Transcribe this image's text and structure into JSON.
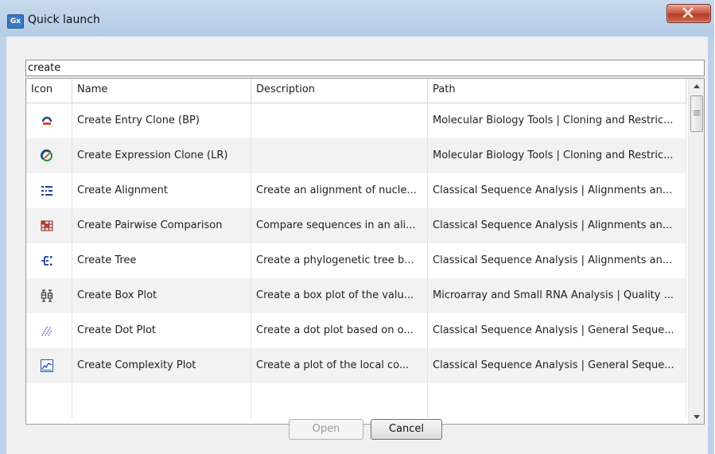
{
  "window": {
    "title": "Quick launch",
    "app_badge": "Gx"
  },
  "search": {
    "value": "create"
  },
  "table": {
    "columns": [
      "Icon",
      "Name",
      "Description",
      "Path"
    ],
    "rows": [
      {
        "icon": "entry-clone-icon",
        "name": "Create Entry Clone (BP)",
        "description": "",
        "path": "Molecular Biology Tools | Cloning and Restric..."
      },
      {
        "icon": "expression-clone-icon",
        "name": "Create Expression Clone (LR)",
        "description": "",
        "path": "Molecular Biology Tools | Cloning and Restric..."
      },
      {
        "icon": "alignment-icon",
        "name": "Create Alignment",
        "description": "Create an alignment of nucle...",
        "path": "Classical Sequence Analysis | Alignments an..."
      },
      {
        "icon": "pairwise-comparison-icon",
        "name": "Create Pairwise Comparison",
        "description": "Compare sequences in an ali...",
        "path": "Classical Sequence Analysis | Alignments an..."
      },
      {
        "icon": "tree-icon",
        "name": "Create Tree",
        "description": "Create a phylogenetic tree b...",
        "path": "Classical Sequence Analysis | Alignments an..."
      },
      {
        "icon": "box-plot-icon",
        "name": "Create Box Plot",
        "description": "Create a box plot of the valu...",
        "path": "Microarray and Small RNA Analysis | Quality ..."
      },
      {
        "icon": "dot-plot-icon",
        "name": "Create Dot Plot",
        "description": "Create a dot plot based on o...",
        "path": "Classical Sequence Analysis | General Seque..."
      },
      {
        "icon": "complexity-plot-icon",
        "name": "Create Complexity Plot",
        "description": "Create a plot of the local co...",
        "path": "Classical Sequence Analysis | General Seque..."
      }
    ]
  },
  "buttons": {
    "open": "Open",
    "cancel": "Cancel"
  },
  "colors": {
    "titlebar": "#bcd2e8",
    "close_button": "#c7543e",
    "row_alt": "#f2f2f2"
  }
}
